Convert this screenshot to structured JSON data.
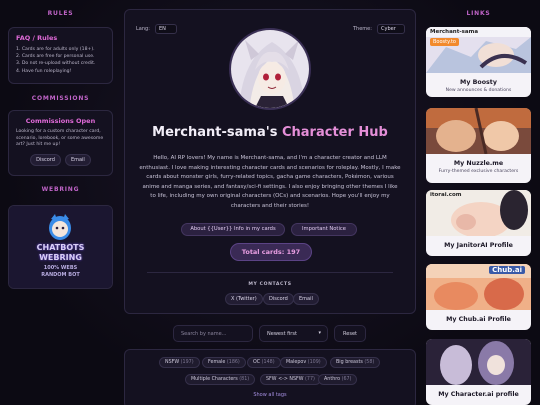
{
  "left": {
    "rules_header": "RULES",
    "rules_title": "FAQ / Rules",
    "rules": [
      "1. Cards are for adults only (18+).",
      "2. Cards are free for personal use.",
      "3. Do not re-upload without credit.",
      "4. Have fun roleplaying!"
    ],
    "commissions_header": "COMMISSIONS",
    "commissions_title": "Commissions Open",
    "commissions_text": "Looking for a custom character card, scenario, lorebook, or some awesome art? Just hit me up!",
    "commission_buttons": [
      "Discord",
      "Email"
    ],
    "webring_header": "WEBRING",
    "webring_lines": [
      "CHATBOTS",
      "WEBRING",
      "100% WEBS",
      "RANDOM BOT"
    ]
  },
  "main": {
    "lang_label": "Lang:",
    "lang_value": "EN",
    "theme_label": "Theme:",
    "theme_value": "Cyber",
    "title_main": "Merchant-sama's ",
    "title_accent": "Character Hub",
    "intro": "Hello, AI RP lovers! My name is Merchant-sama, and I'm a character creator and LLM enthusiast. I love making interesting character cards and scenarios for roleplay. Mostly, I make cards about monster girls, furry-related topics, gacha game characters, Pokémon, various anime and manga series, and fantasy/sci-fi settings. I also enjoy bringing other themes I like to life, including my own original characters (OCs) and scenarios. Hope you'll enjoy my characters and their stories!",
    "btn_about": "About {{User}} Info in my cards",
    "btn_notice": "Important Notice",
    "total_label": "Total cards: 197",
    "contacts_title": "MY CONTACTS",
    "contacts": [
      "X (Twitter)",
      "Discord",
      "Email"
    ]
  },
  "search": {
    "placeholder": "Search by name...",
    "sort_value": "Newest first",
    "reset_label": "Reset"
  },
  "tags": [
    {
      "label": "NSFW",
      "count": "(197)"
    },
    {
      "label": "Female",
      "count": "(186)"
    },
    {
      "label": "OC",
      "count": "(148)"
    },
    {
      "label": "Malepov",
      "count": "(109)"
    },
    {
      "label": "Big breasts",
      "count": "(58)"
    },
    {
      "label": "Multiple Characters",
      "count": "(81)"
    },
    {
      "label": "SFW <-> NSFW",
      "count": "(77)"
    },
    {
      "label": "Anthro",
      "count": "(67)"
    }
  ],
  "show_all": "Show all tags",
  "right": {
    "links_header": "LINKS",
    "cards": [
      {
        "banner": "Merchant-sama",
        "banner2": "Boosty.to",
        "title": "My Boosty",
        "subtitle": "New announces & donations"
      },
      {
        "banner": "",
        "banner2": "",
        "title": "My Nuzzle.me",
        "subtitle": "Furry-themed exclusive characters"
      },
      {
        "banner": "itorai.com",
        "banner2": "",
        "title": "My JanitorAI Profile",
        "subtitle": ""
      },
      {
        "banner": "Chub.ai",
        "banner2": "",
        "title": "My Chub.ai Profile",
        "subtitle": ""
      },
      {
        "banner": "",
        "banner2": "",
        "title": "My Character.ai profile",
        "subtitle": ""
      }
    ]
  },
  "colors": {
    "accent": "#e06ad8",
    "bg": "#0c0a13",
    "panel": "#141120"
  }
}
